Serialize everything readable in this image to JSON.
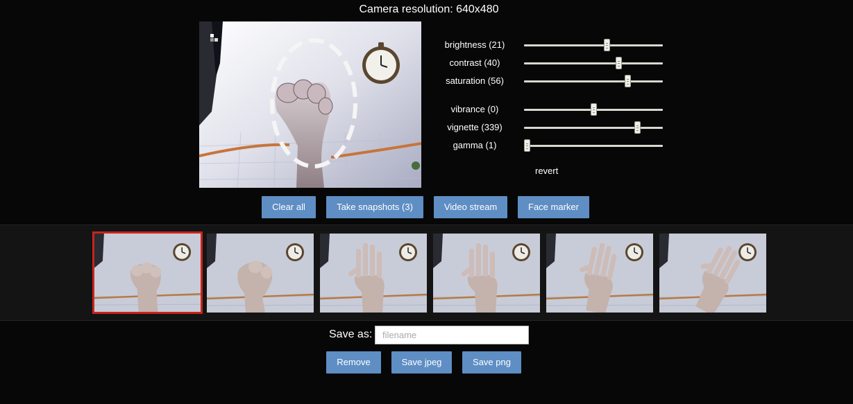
{
  "header": {
    "title": "Camera resolution: 640x480"
  },
  "sliders": [
    {
      "label": "brightness (21)",
      "value": 0.6
    },
    {
      "label": "contrast (40)",
      "value": 0.69
    },
    {
      "label": "saturation (56)",
      "value": 0.76
    },
    {
      "label": "vibrance (0)",
      "value": 0.5
    },
    {
      "label": "vignette (339)",
      "value": 0.83
    },
    {
      "label": "gamma (1)",
      "value": 0.0
    }
  ],
  "revert_label": "revert",
  "actions": {
    "clear_all": "Clear all",
    "take_snapshots": "Take snapshots (3)",
    "video_stream": "Video stream",
    "face_marker": "Face marker"
  },
  "snapshots": [
    {
      "pose": "fist",
      "selected": true
    },
    {
      "pose": "fist-turning",
      "selected": false
    },
    {
      "pose": "open-hand",
      "selected": false
    },
    {
      "pose": "open-hand",
      "selected": false
    },
    {
      "pose": "open-hand-tilted",
      "selected": false
    },
    {
      "pose": "open-hand-side",
      "selected": false
    }
  ],
  "save": {
    "label": "Save as:",
    "placeholder": "filename",
    "value": ""
  },
  "file_actions": {
    "remove": "Remove",
    "save_jpeg": "Save jpeg",
    "save_png": "Save png"
  },
  "colors": {
    "button": "#5e8ec4",
    "selected_border": "#c8241c",
    "background": "#070707"
  },
  "icons": {
    "clock": "wall-clock-icon",
    "face_marker_overlay": "dashed-ellipse"
  }
}
